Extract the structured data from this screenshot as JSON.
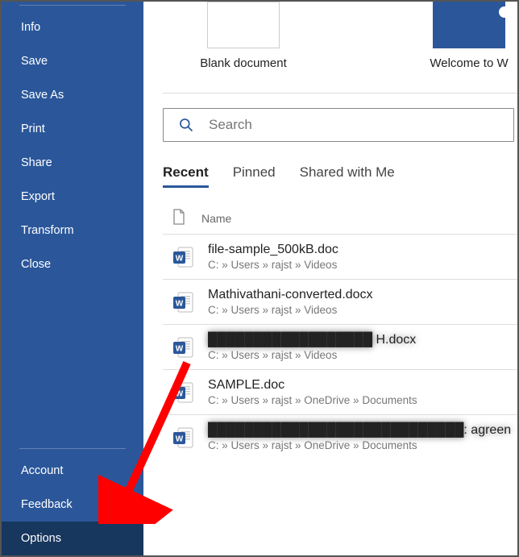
{
  "sidebar": {
    "items": [
      {
        "label": "Info"
      },
      {
        "label": "Save"
      },
      {
        "label": "Save As"
      },
      {
        "label": "Print"
      },
      {
        "label": "Share"
      },
      {
        "label": "Export"
      },
      {
        "label": "Transform"
      },
      {
        "label": "Close"
      }
    ],
    "footer": [
      {
        "label": "Account"
      },
      {
        "label": "Feedback"
      },
      {
        "label": "Options",
        "active": true
      }
    ]
  },
  "templates": {
    "blank": "Blank document",
    "welcome": "Welcome to W"
  },
  "search": {
    "placeholder": "Search"
  },
  "tabs": {
    "recent": "Recent",
    "pinned": "Pinned",
    "shared": "Shared with Me"
  },
  "list_header": {
    "name": "Name"
  },
  "files": [
    {
      "name": "file-sample_500kB.doc",
      "path": "C: » Users » rajst » Videos",
      "type": "doc"
    },
    {
      "name": "Mathivathani-converted.docx",
      "path": "C: » Users » rajst » Videos",
      "type": "docx"
    },
    {
      "name": "██████████████████ H.docx",
      "path": "C: » Users » rajst » Videos",
      "type": "docx",
      "redacted": true
    },
    {
      "name": "SAMPLE.doc",
      "path": "C: » Users » rajst » OneDrive » Documents",
      "type": "doc"
    },
    {
      "name": "████████████████████████████: agreen",
      "path": "C: » Users » rajst » OneDrive » Documents",
      "type": "docx",
      "redacted": true
    }
  ],
  "annotation": {
    "arrow_color": "#ff0000",
    "arrow_target": "Options"
  }
}
